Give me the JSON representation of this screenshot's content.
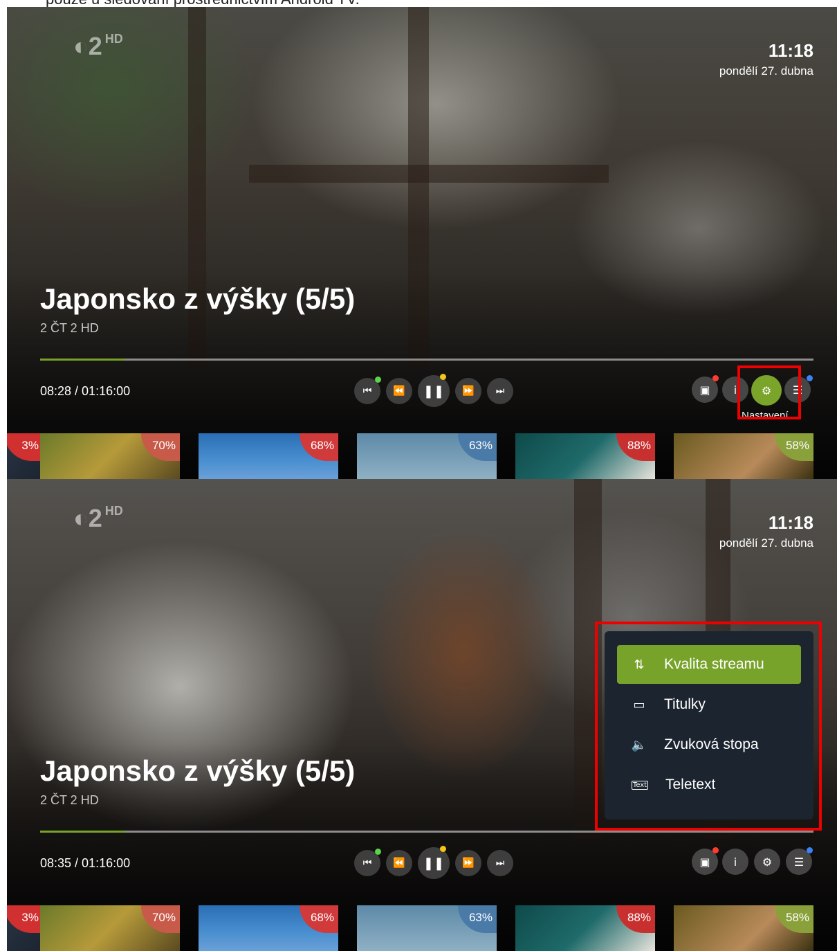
{
  "doc": {
    "text": "pouze u sledování prostřednictvím Android TV."
  },
  "screens": [
    {
      "channel_logo": "2",
      "channel_logo_hd": "HD",
      "time": "11:18",
      "date": "pondělí 27. dubna",
      "title": "Japonsko z výšky (5/5)",
      "channel": "2 ČT 2 HD",
      "progress": 0.11,
      "timecode": "08:28 / 01:16:00",
      "controls": {
        "prev": "⏮",
        "rewind": "⏪",
        "pause": "❚❚",
        "forward": "⏩",
        "next": "⏭"
      },
      "right_buttons": {
        "record": "▣",
        "info": "i",
        "settings": "⚙",
        "menu": "☰"
      },
      "tooltip": "Nastavení",
      "thumbs": [
        "3%",
        "70%",
        "68%",
        "63%",
        "88%",
        "58%"
      ]
    },
    {
      "channel_logo": "2",
      "channel_logo_hd": "HD",
      "time": "11:18",
      "date": "pondělí 27. dubna",
      "title": "Japonsko z výšky (5/5)",
      "channel": "2 ČT 2 HD",
      "progress": 0.11,
      "timecode": "08:35 / 01:16:00",
      "controls": {
        "prev": "⏮",
        "rewind": "⏪",
        "pause": "❚❚",
        "forward": "⏩",
        "next": "⏭"
      },
      "right_buttons": {
        "record": "▣",
        "info": "i",
        "settings": "⚙",
        "menu": "☰"
      },
      "menu": {
        "items": [
          {
            "label": "Kvalita streamu",
            "icon": "sliders-icon",
            "glyph": "⇅"
          },
          {
            "label": "Titulky",
            "icon": "subtitles-icon",
            "glyph": "▭"
          },
          {
            "label": "Zvuková stopa",
            "icon": "speaker-icon",
            "glyph": "🔈"
          },
          {
            "label": "Teletext",
            "icon": "teletext-icon",
            "glyph": "Text"
          }
        ]
      },
      "thumbs": [
        "3%",
        "70%",
        "68%",
        "63%",
        "88%",
        "58%"
      ]
    }
  ],
  "colors": {
    "accent": "#78a32a",
    "highlight": "#e00000",
    "menu_bg": "#1c2430"
  }
}
